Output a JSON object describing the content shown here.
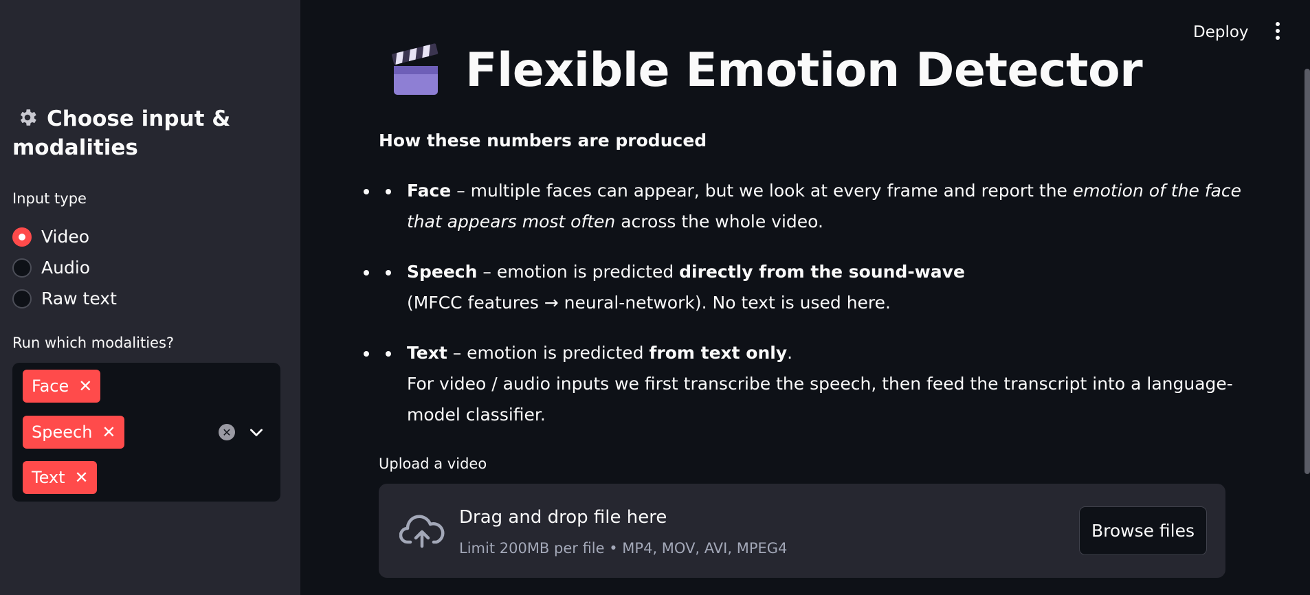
{
  "sidebar": {
    "heading": "Choose input & modalities",
    "input_type_label": "Input type",
    "input_options": [
      {
        "label": "Video",
        "selected": true
      },
      {
        "label": "Audio",
        "selected": false
      },
      {
        "label": "Raw text",
        "selected": false
      }
    ],
    "modalities_label": "Run which modalities?",
    "modalities_selected": [
      "Face",
      "Speech",
      "Text"
    ],
    "tag_remove_symbol": "✕",
    "clear_symbol": "✕"
  },
  "header": {
    "deploy_label": "Deploy"
  },
  "main": {
    "title": "Flexible Emotion Detector",
    "subheading": "How these numbers are produced",
    "bullets": {
      "face": {
        "term": "Face",
        "text1": " – multiple faces can appear, but we look at every frame and report the ",
        "emph": "emotion of the face that appears most often",
        "text2": " across the whole video."
      },
      "speech": {
        "term": "Speech",
        "text1": " – emotion is predicted ",
        "strong": "directly from the sound-wave",
        "line2": "(MFCC features → neural-network). No text is used here."
      },
      "text": {
        "term": "Text",
        "text1": " – emotion is predicted ",
        "strong": "from text only",
        "text2": ".",
        "line2": "For video / audio inputs we first transcribe the speech, then feed the transcript into a language-model classifier."
      }
    },
    "upload_label": "Upload a video",
    "dropzone": {
      "title": "Drag and drop file here",
      "subtitle": "Limit 200MB per file • MP4, MOV, AVI, MPEG4",
      "button": "Browse files"
    }
  },
  "colors": {
    "accent": "#ff4b4b",
    "sidebar_bg": "#262730",
    "main_bg": "#0e1117"
  }
}
